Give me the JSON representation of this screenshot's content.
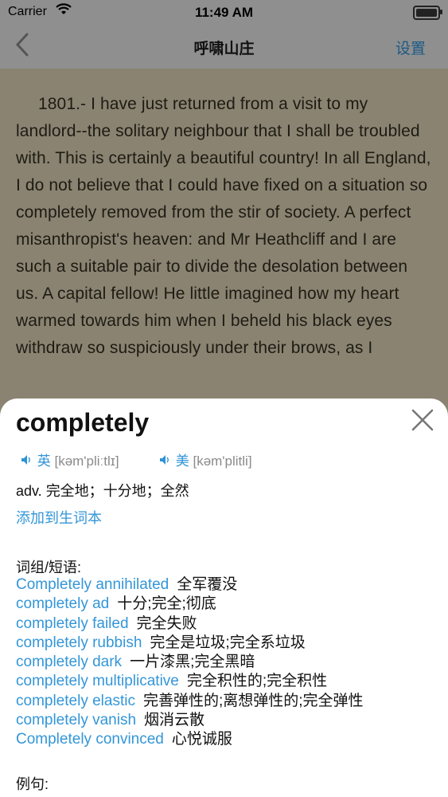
{
  "status": {
    "carrier": "Carrier",
    "time": "11:49 AM"
  },
  "nav": {
    "back_icon": "chevron-left-icon",
    "title": "呼啸山庄",
    "settings": "设置"
  },
  "reader": {
    "text": "1801.- I have just returned from a visit to my landlord--the solitary neighbour that I shall be troubled with. This is certainly a beautiful country! In all England, I do not believe that I could have fixed on a situation so completely removed from the stir of society. A perfect misanthropist's heaven: and Mr Heathcliff and I are such a suitable pair to divide the desolation between us. A capital fellow! He little imagined how my heart warmed towards him when I beheld his black eyes withdraw so suspiciously under their brows, as I"
  },
  "dict": {
    "word": "completely",
    "close_icon": "close-icon",
    "uk_label": "英",
    "uk_phonetic": "[kəm'pliːtlɪ]",
    "us_label": "美",
    "us_phonetic": "[kəm'plitli]",
    "definition": "adv. 完全地；十分地；全然",
    "add_label": "添加到生词本",
    "phrases_heading": "词组/短语:",
    "phrases": [
      {
        "en": "Completely annihilated",
        "zh": "全军覆没"
      },
      {
        "en": "completely ad",
        "zh": "十分;完全;彻底"
      },
      {
        "en": "completely failed",
        "zh": "完全失败"
      },
      {
        "en": "completely rubbish",
        "zh": "完全是垃圾;完全系垃圾"
      },
      {
        "en": "completely dark",
        "zh": "一片漆黑;完全黑暗"
      },
      {
        "en": "completely multiplicative",
        "zh": "完全积性的;完全积性"
      },
      {
        "en": "completely elastic",
        "zh": "完善弹性的;离想弹性的;完全弹性"
      },
      {
        "en": "completely vanish",
        "zh": "烟消云散"
      },
      {
        "en": "Completely convinced",
        "zh": "心悦诚服"
      }
    ],
    "examples_heading": "例句:"
  }
}
